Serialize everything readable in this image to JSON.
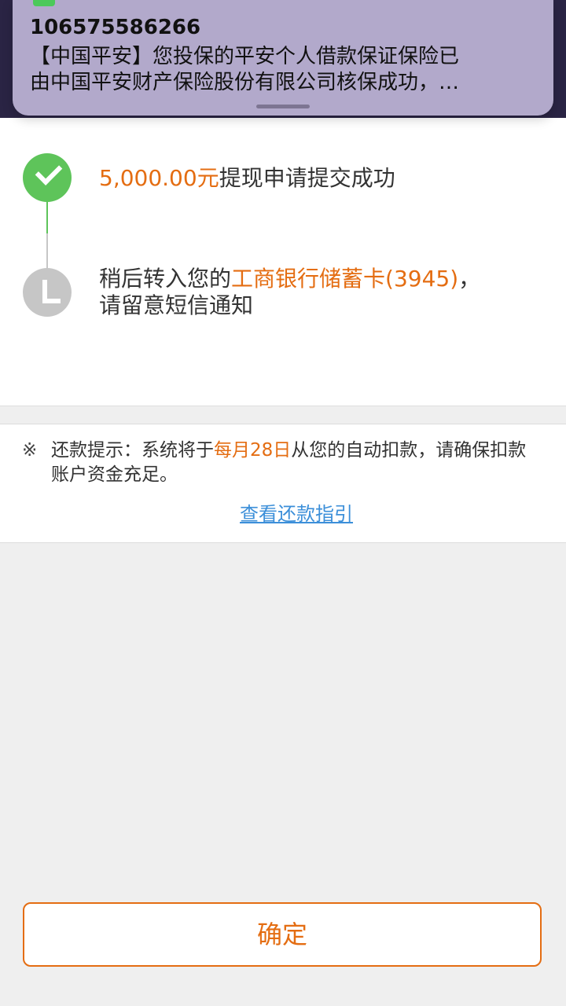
{
  "notification": {
    "sender": "10657558626​6",
    "body_line1": "【中国平安】您投保的平安个人借款保证保险已",
    "body_line2": "由中国平安财产保险股份有限公司核保成功，…",
    "icon": "sms-app-icon"
  },
  "steps": [
    {
      "amount": "5,000.00元",
      "text": "提现申请提交成功",
      "status": "done",
      "icon": "check-icon",
      "color": "#5ec45a"
    },
    {
      "prefix": "稍后转入您的",
      "bank": "工商银行储蓄卡(3945)",
      "suffix": "，",
      "line2": "请留意短信通知",
      "status": "pending",
      "icon": "clock-icon",
      "color": "#c6c6c6"
    }
  ],
  "notice": {
    "mark": "※",
    "prefix": "还款提示：系统将于",
    "date": "每月28日",
    "suffix": "从您的自动扣款，请确保扣款账户资金充足。",
    "link": "查看还款指引"
  },
  "confirm_button": "确定",
  "colors": {
    "accent": "#e46d12",
    "link": "#3c8fd9",
    "success": "#5ec45a",
    "pending": "#c6c6c6"
  }
}
